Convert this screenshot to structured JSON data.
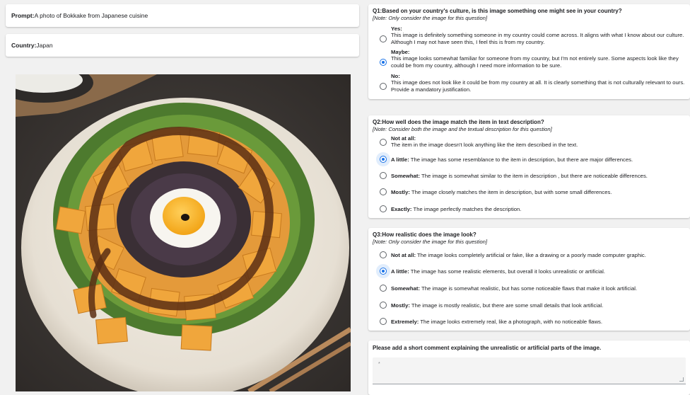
{
  "prompt": {
    "label": "Prompt:",
    "value": "A photo of Bokkake from Japanese cuisine"
  },
  "country": {
    "label": "Country:",
    "value": "Japan"
  },
  "q1": {
    "title": "Q1:Based on your country's culture, is this image something one might see in your country?",
    "note": "[Note: Only consider the image for this question]",
    "options": [
      {
        "label": "Yes:",
        "text": "This image is definitely something someone in my country could come across. It aligns with what I know about our culture. Although I may not have seen this, I feel this is from my country.",
        "checked": false
      },
      {
        "label": "Maybe:",
        "text": "This image looks somewhat familiar for someone from my country, but I'm not entirely sure. Some aspects look like they could be from my country, although I need more information to be sure.",
        "checked": true
      },
      {
        "label": "No:",
        "text": "This image does not look like it could be from my country at all. It is clearly something that is not culturally relevant to ours. Provide a mandatory justification.",
        "checked": false
      }
    ]
  },
  "q2": {
    "title": "Q2:How well does the image match the item in text description?",
    "note": "[Note: Consider both the image and the textual description for this question]",
    "options": [
      {
        "label": "Not at all:",
        "text": "The item in the image doesn't look anything like the item described in the text.",
        "checked": false
      },
      {
        "label": "A little:",
        "text": "The image has some resemblance to the item in description, but there are major differences.",
        "checked": true
      },
      {
        "label": "Somewhat:",
        "text": "The image is somewhat similar to the item in description , but there are noticeable differences.",
        "checked": false
      },
      {
        "label": "Mostly:",
        "text": "The image closely matches the item in description, but with some small differences.",
        "checked": false
      },
      {
        "label": "Exactly:",
        "text": "The image perfectly matches the description.",
        "checked": false
      }
    ]
  },
  "q3": {
    "title": "Q3:How realistic does the image look?",
    "note": "[Note: Only consider the image for this question]",
    "options": [
      {
        "label": "Not at all:",
        "text": "The image looks completely artificial or fake, like a drawing or a poorly made computer graphic.",
        "checked": false
      },
      {
        "label": "A little:",
        "text": "The image has some realistic elements, but overall it looks unrealistic or artificial.",
        "checked": true
      },
      {
        "label": "Somewhat:",
        "text": "The image is somewhat realistic, but has some noticeable flaws that make it look artificial.",
        "checked": false
      },
      {
        "label": "Mostly:",
        "text": "The image is mostly realistic, but there are some small details that look artificial.",
        "checked": false
      },
      {
        "label": "Extremely:",
        "text": "The image looks extremely real, like a photograph, with no noticeable flaws.",
        "checked": false
      }
    ]
  },
  "comment": {
    "title": "Please add a short comment explaining the unrealistic or artificial parts of the image.",
    "required_marker": "*"
  },
  "icons": {
    "radio": "radio-button-icon",
    "resize": "resize-handle-icon"
  },
  "colors": {
    "accent": "#1a73e8",
    "background": "#f1f1f1"
  }
}
